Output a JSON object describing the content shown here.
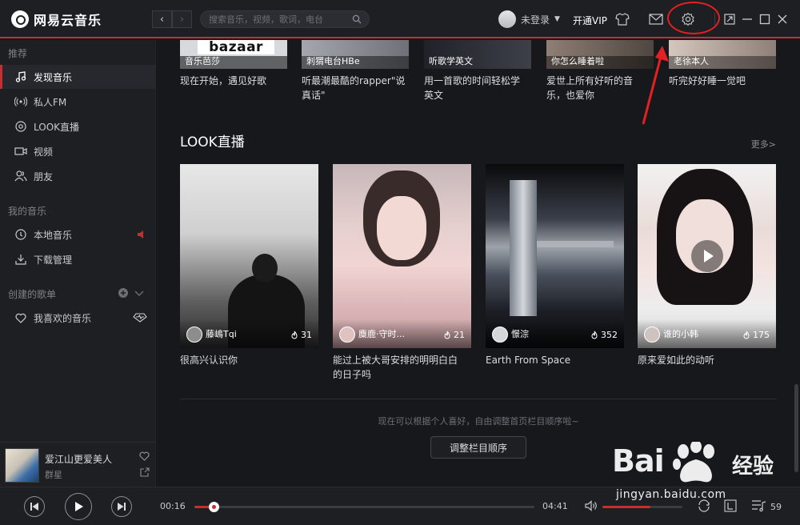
{
  "app": {
    "name": "网易云音乐",
    "search_placeholder": "搜索音乐，视频，歌词，电台",
    "login_text": "未登录",
    "vip_label": "开通VIP"
  },
  "sidebar": {
    "sections": [
      {
        "title": "推荐",
        "items": [
          {
            "label": "发现音乐",
            "icon": "music-note-icon",
            "active": true
          },
          {
            "label": "私人FM",
            "icon": "radio-icon"
          },
          {
            "label": "LOOK直播",
            "icon": "live-icon"
          },
          {
            "label": "视频",
            "icon": "video-icon"
          },
          {
            "label": "朋友",
            "icon": "friends-icon"
          }
        ]
      },
      {
        "title": "我的音乐",
        "items": [
          {
            "label": "本地音乐",
            "icon": "disc-icon"
          },
          {
            "label": "下载管理",
            "icon": "download-icon"
          }
        ]
      },
      {
        "title": "创建的歌单",
        "items": [
          {
            "label": "我喜欢的音乐",
            "icon": "heart-icon"
          }
        ]
      }
    ],
    "now_playing": {
      "title": "爱江山更爱美人",
      "artist": "群星"
    }
  },
  "top_cards": [
    {
      "thumb_label": "音乐芭莎",
      "logo_text": "bazaar",
      "caption": [
        "现在开始，遇见好歌"
      ],
      "tone": "#d8d9dc"
    },
    {
      "thumb_label": "刺猬电台HBe",
      "caption": [
        "听最潮最酷的rapper\"说",
        "真话\""
      ],
      "tone": "#8c8f96"
    },
    {
      "thumb_label": "听歌学英文",
      "caption": [
        "用一首歌的时间轻松学",
        "英文"
      ],
      "tone": "#2e3138"
    },
    {
      "thumb_label": "你怎么睡着啦",
      "caption": [
        "爱世上所有好听的音",
        "乐，也爱你"
      ],
      "tone": "#6b5f58"
    },
    {
      "thumb_label": "老徐本人",
      "caption": [
        "听完好好睡一觉吧"
      ],
      "tone": "#b6a9a0"
    }
  ],
  "look": {
    "title": "LOOK直播",
    "more": "更多>",
    "cards": [
      {
        "host": "藤嶋Tqi",
        "count": "31",
        "caption": [
          "很高兴认识你"
        ],
        "bg": "linear-gradient(180deg,#e7e7e7 0%,#cfcfcf 38%,#9a9a9a 55%,#5e5e5e 75%,#2c2c2c 100%)",
        "avatar": "#8d8d8d"
      },
      {
        "host": "麋鹿·守时...",
        "count": "21",
        "caption": [
          "能过上被大哥安排的明明白白",
          "的日子吗"
        ],
        "bg": "linear-gradient(180deg,#c7b7b9 0%,#e6d0cf 35%,#f0d5d3 55%,#d9b3b5 80%,#c49da1 100%)",
        "avatar": "#e0c2c0"
      },
      {
        "host": "憬淙",
        "count": "352",
        "caption": [
          "Earth From Space"
        ],
        "bg": "linear-gradient(180deg,#0a0a0c 0%,#3a3f4a 30%,#9ea3ab 45%,#4a505c 60%,#1b1e24 80%,#0a0b0e 100%)",
        "avatar": "#d6d6d8"
      },
      {
        "host": "谁的小韩",
        "count": "175",
        "caption": [
          "原来爱如此的动听"
        ],
        "bg": "linear-gradient(180deg,#f1f1f1 0%,#e9dcd8 35%,#f3e3e0 55%,#ededed 78%,#d8d8d8 100%)",
        "avatar": "#cfc3bf",
        "has_play": true
      }
    ]
  },
  "footer": {
    "hint": "现在可以根据个人喜好，自由调整首页栏目顺序啦~",
    "reorder_button": "调整栏目顺序"
  },
  "player": {
    "elapsed": "00:16",
    "duration": "04:41",
    "progress": 0.057,
    "volume": 0.6,
    "playlist_count": "59"
  },
  "watermark": {
    "brand_left": "Bai",
    "brand_suffix": "经验",
    "url": "jingyan.baidu.com"
  },
  "colors": {
    "accent": "#c62f2f",
    "annotation": "#e42020",
    "background": "#16181c",
    "panel": "#1d1f23"
  }
}
